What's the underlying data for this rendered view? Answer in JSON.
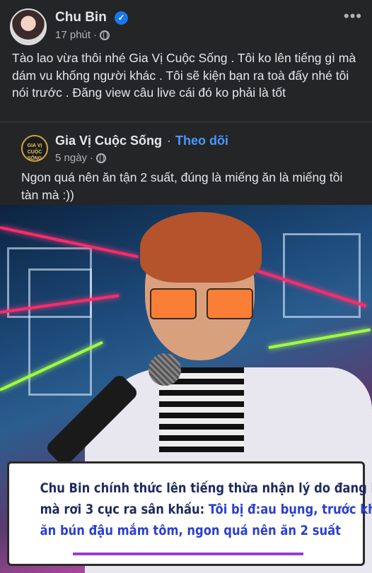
{
  "post": {
    "author": "Chu Bin",
    "time": "17 phút",
    "separator": "·",
    "text": "Tào lao vừa thôi nhé Gia Vị Cuộc Sống . Tôi ko lên tiếng gì mà dám vu khống người khác . Tôi sẽ kiện bạn ra toà đấy nhé tôi nói trước . Đăng view câu live cái đó ko phải là tốt"
  },
  "shared": {
    "page_name": "Gia Vị Cuộc Sống",
    "dot": "·",
    "follow_label": "Theo dõi",
    "time": "5 ngày",
    "separator": "·",
    "avatar_text": "GIA VỊ CUỘC SỐNG",
    "text": "Ngon quá nên ăn tận 2 suất, đúng là miếng ăn là miếng tồi tàn mà :))"
  },
  "image_caption": {
    "part1_line1": "Chu Bin chính thức lên tiếng thừa nhận lý do đang hát",
    "part1_line2": "mà rơi 3 cục ra sân khấu: ",
    "part2_line2": "Tôi bị đ:au bụng, trước khi diễn",
    "part2_line3": "ăn bún đậu mắm tôm, ngon quá nên ăn 2 suất"
  },
  "icons": {
    "verified": "verified-badge-icon",
    "globe": "globe-icon",
    "more": "more-options-icon"
  },
  "colors": {
    "background": "#242526",
    "link": "#4599ff",
    "verified": "#1877f2",
    "caption_dark": "#1f2a5e",
    "caption_blue": "#2b3fd1"
  }
}
